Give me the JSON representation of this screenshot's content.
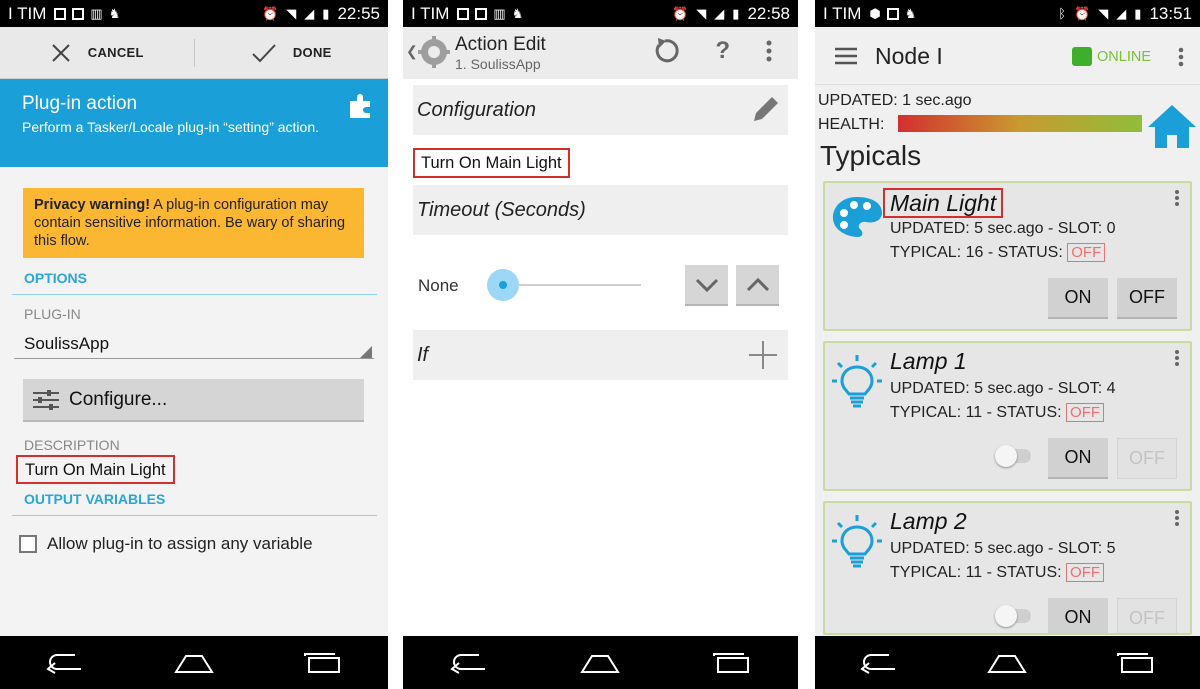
{
  "status": {
    "carrier": "I TIM",
    "time1": "22:55",
    "time2": "22:58",
    "time3": "13:51"
  },
  "screen1": {
    "cancel_label": "CANCEL",
    "done_label": "DONE",
    "header_title": "Plug-in action",
    "header_desc": "Perform a Tasker/Locale plug-in “setting” action.",
    "warning_bold": "Privacy warning!",
    "warning_text": " A plug-in configuration may contain sensitive information. Be wary of sharing this flow.",
    "options_label": "OPTIONS",
    "plugin_label": "PLUG-IN",
    "plugin_value": "SoulissApp",
    "configure_label": "Configure...",
    "description_label": "DESCRIPTION",
    "description_value": "Turn On Main Light",
    "output_label": "OUTPUT VARIABLES",
    "allow_label": "Allow plug-in to assign any variable"
  },
  "screen2": {
    "title": "Action Edit",
    "subtitle": "1. SoulissApp",
    "configuration_label": "Configuration",
    "config_value": "Turn On Main Light",
    "timeout_label": "Timeout (Seconds)",
    "timeout_value": "None",
    "timeout_level": 0,
    "if_label": "If"
  },
  "screen3": {
    "title": "Node I",
    "online_label": "ONLINE",
    "updated_text": "UPDATED: 1 sec.ago",
    "health_label": "HEALTH:",
    "typicals_label": "Typicals",
    "cards": [
      {
        "name": "Main Light",
        "line1": "UPDATED: 5 sec.ago - SLOT: 0",
        "line2": "TYPICAL: 16 - STATUS:",
        "status": "OFF",
        "on": "ON",
        "off": "OFF",
        "icon": "palette-icon"
      },
      {
        "name": "Lamp 1",
        "line1": "UPDATED: 5 sec.ago - SLOT: 4",
        "line2": "TYPICAL: 11 - STATUS:",
        "status": "OFF",
        "on": "ON",
        "off": "OFF",
        "icon": "lightbulb-icon"
      },
      {
        "name": "Lamp 2",
        "line1": "UPDATED: 5 sec.ago - SLOT: 5",
        "line2": "TYPICAL: 11 - STATUS:",
        "status": "OFF",
        "on": "ON",
        "off": "OFF",
        "icon": "lightbulb-icon"
      }
    ]
  },
  "colors": {
    "accent_blue": "#1a9fd8",
    "warning_orange": "#fbb731",
    "highlight_red": "#d32f2f",
    "online_green": "#3fae2a"
  }
}
